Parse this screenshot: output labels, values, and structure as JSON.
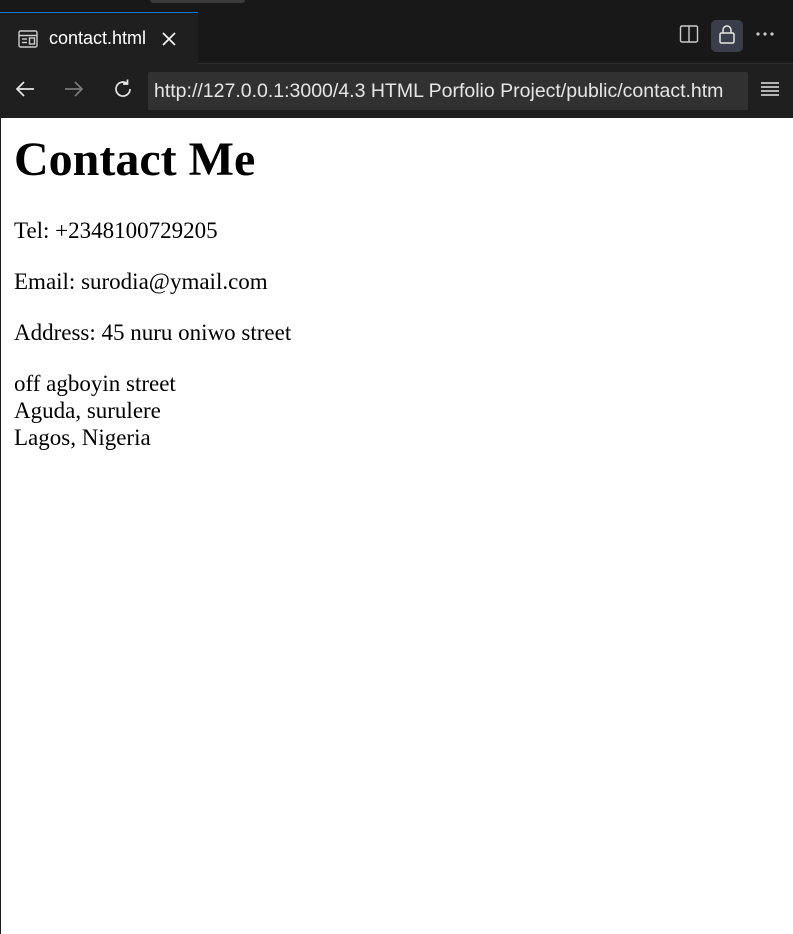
{
  "tab": {
    "title": "contact.html",
    "icon": "preview-icon"
  },
  "tab_actions": {
    "split_icon": "split-editor-icon",
    "lock_icon": "lock-icon",
    "more_icon": "more-actions-icon"
  },
  "nav": {
    "url": "http://127.0.0.1:3000/4.3 HTML Porfolio Project/public/contact.htm"
  },
  "page": {
    "heading": "Contact Me",
    "tel": "Tel: +2348100729205",
    "email": "Email: surodia@ymail.com",
    "address": "Address: 45 nuru oniwo street",
    "address_lines": [
      "off agboyin street",
      "Aguda, surulere",
      "Lagos, Nigeria"
    ]
  },
  "colors": {
    "chrome_dark": "#181818",
    "tab_active": "#1f1f1f",
    "accent": "#0078d4",
    "url_bg": "#313131",
    "page_bg": "#ffffff"
  }
}
